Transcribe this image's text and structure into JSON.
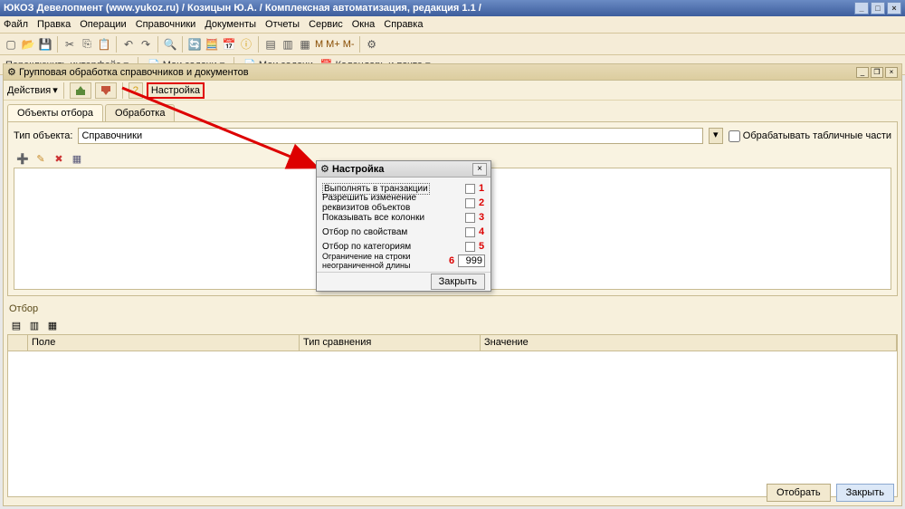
{
  "title": "ЮКОЗ Девелопмент (www.yukoz.ru) / Козицын Ю.А. / Комплексная автоматизация, редакция 1.1 /",
  "menu": [
    "Файл",
    "Правка",
    "Операции",
    "Справочники",
    "Документы",
    "Отчеты",
    "Сервис",
    "Окна",
    "Справка"
  ],
  "subtoolbar": {
    "switch_iface": "Переключить интерфейс",
    "my_tasks_btn": "Мои задачи",
    "my_tasks": "Мои задачи",
    "calendar": "Календарь и почта"
  },
  "childwin": {
    "title": "Групповая обработка справочников и документов",
    "actions_label": "Действия",
    "settings_btn": "Настройка",
    "tabs": [
      "Объекты отбора",
      "Обработка"
    ],
    "type_label": "Тип объекта:",
    "type_value": "Справочники",
    "process_tabparts": "Обрабатывать табличные части",
    "filter_label": "Отбор",
    "cols": [
      "",
      "Поле",
      "Тип сравнения",
      "Значение"
    ],
    "btn_select": "Отобрать",
    "btn_close": "Закрыть"
  },
  "dialog": {
    "title": "Настройка",
    "rows": [
      {
        "label": "Выполнять в транзакции",
        "n": "1"
      },
      {
        "label": "Разрешить изменение реквизитов объектов",
        "n": "2"
      },
      {
        "label": "Показывать все колонки",
        "n": "3"
      },
      {
        "label": "Отбор по свойствам",
        "n": "4"
      },
      {
        "label": "Отбор по категориям",
        "n": "5"
      }
    ],
    "limit_label": "Ограничение на строки неограниченной длины",
    "limit_n": "6",
    "limit_val": "999",
    "close": "Закрыть"
  }
}
